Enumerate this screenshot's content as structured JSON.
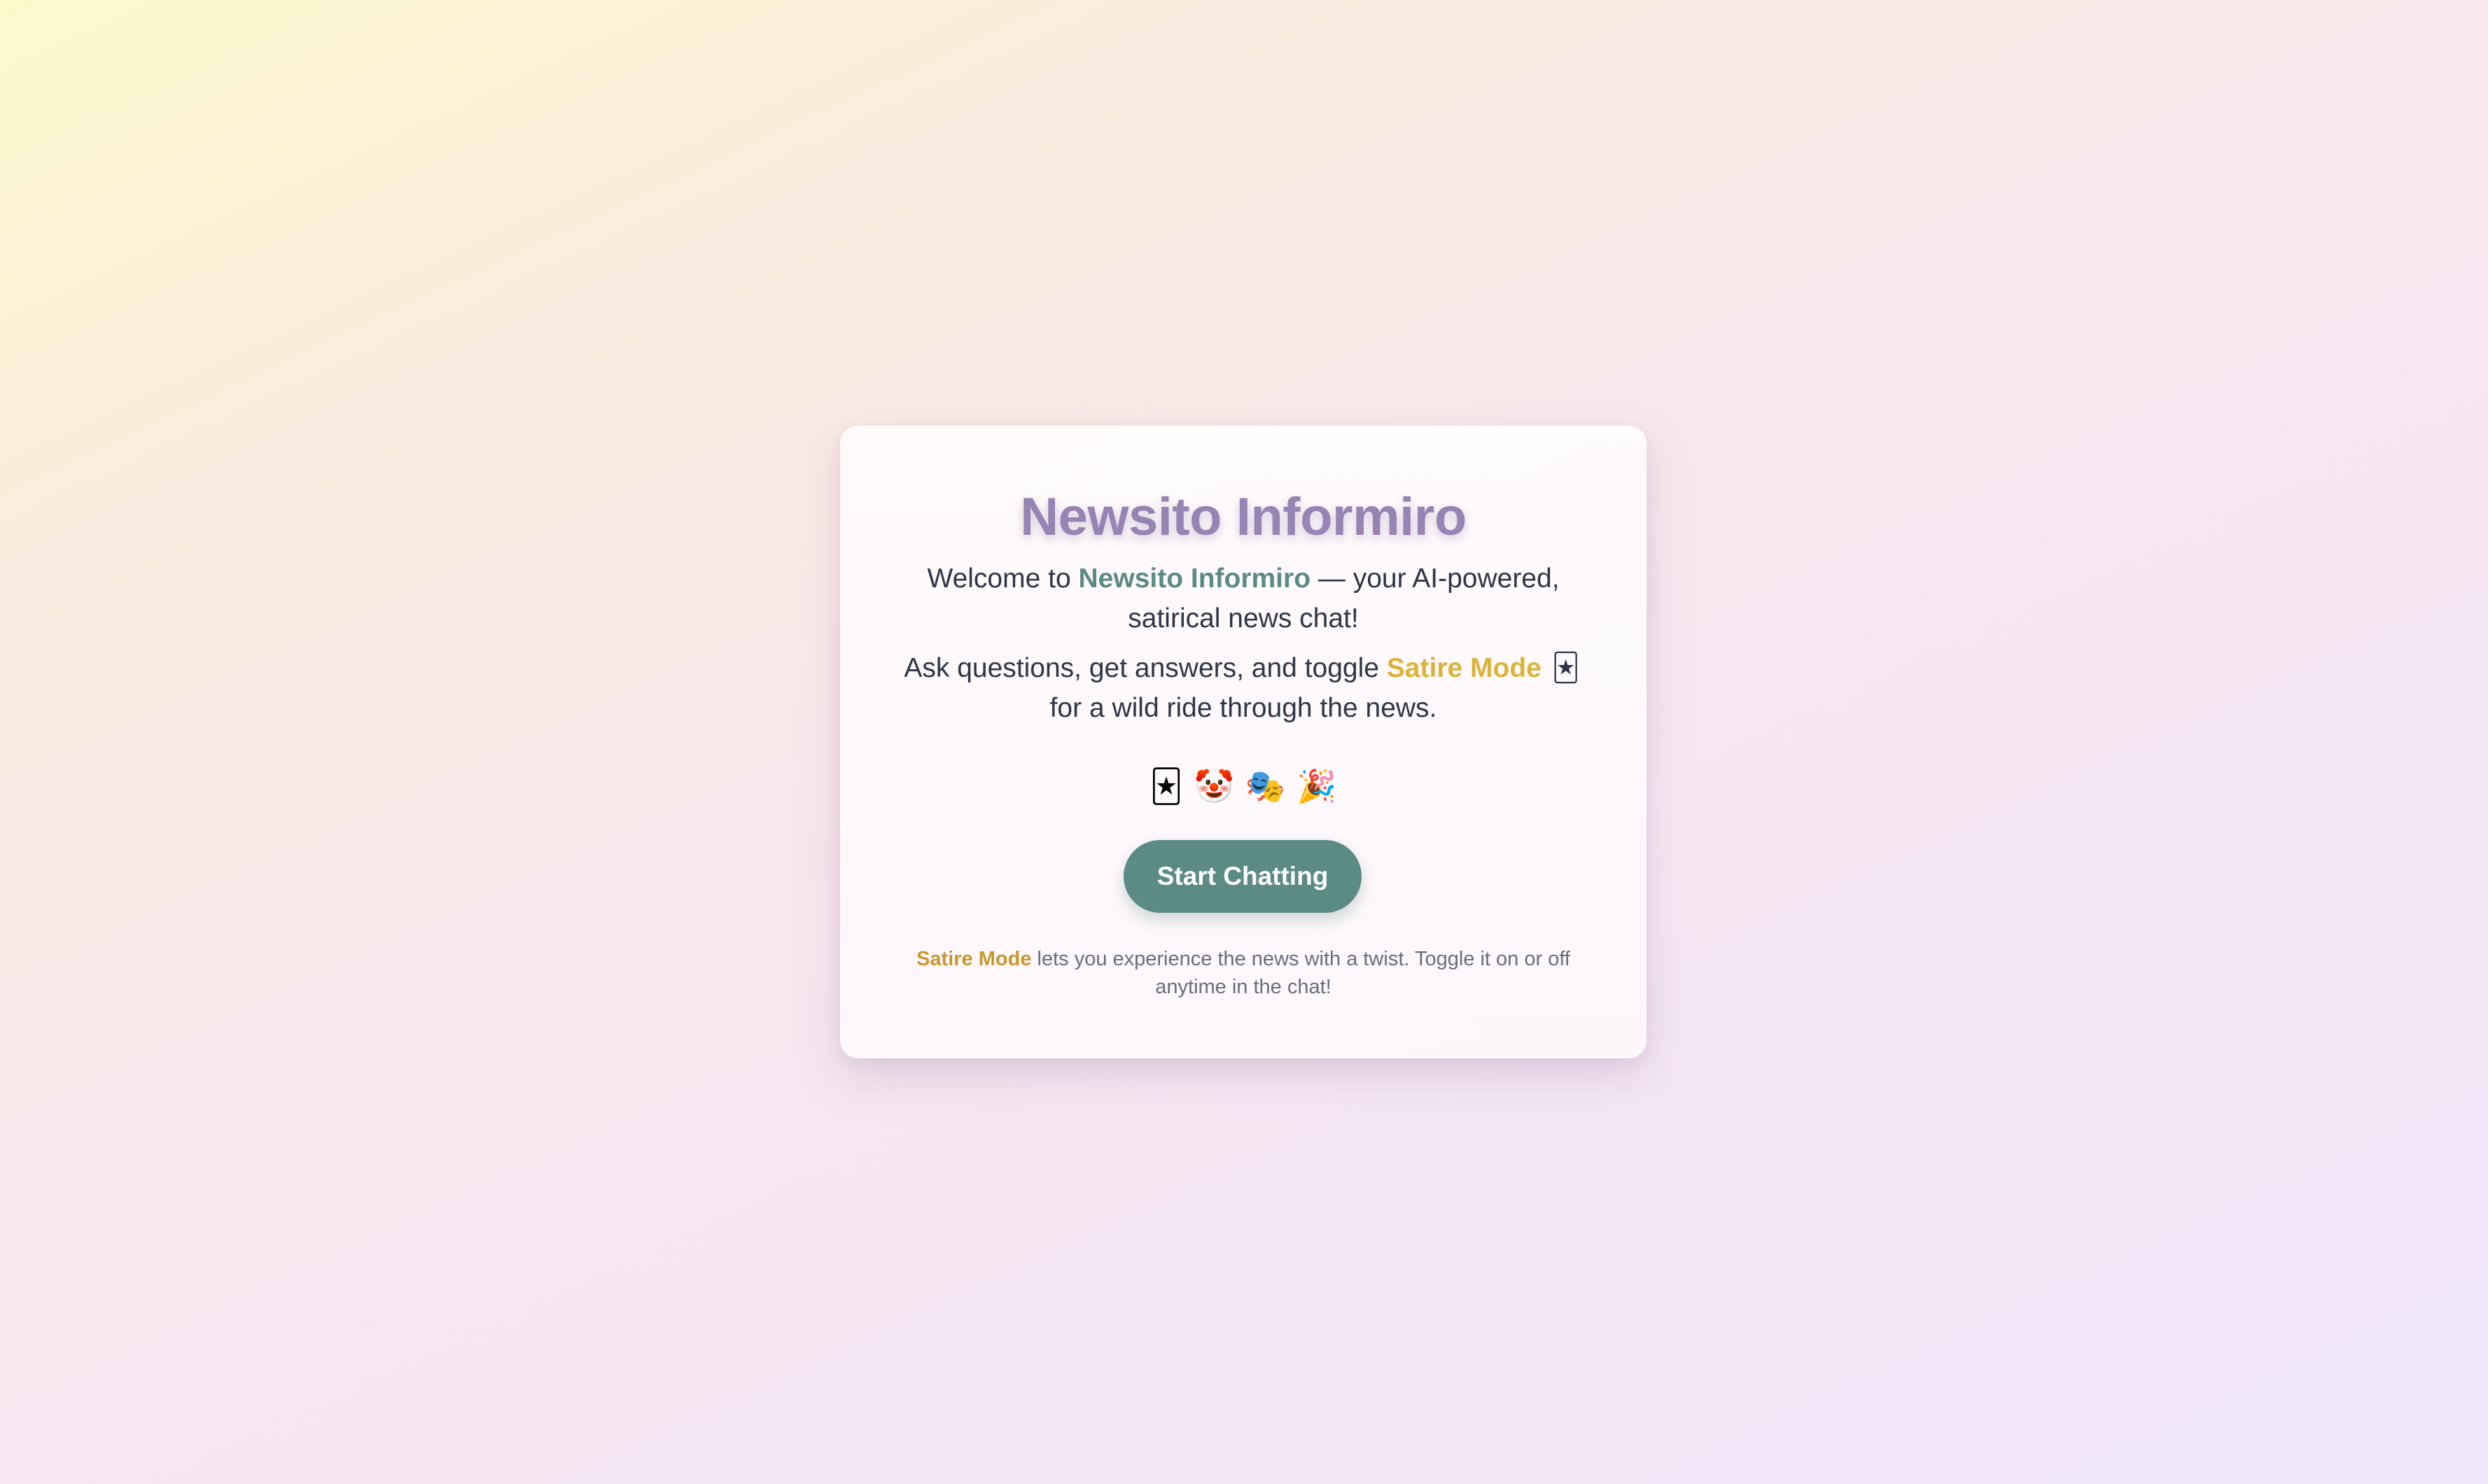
{
  "card": {
    "title": "Newsito Informiro",
    "intro_line1": {
      "prefix": "Welcome to ",
      "brand": "Newsito Informiro",
      "suffix": " — your AI-powered, satirical news chat!"
    },
    "intro_line2": {
      "prefix": "Ask questions, get answers, and toggle ",
      "satire_mode": "Satire Mode",
      "emoji": "🃏",
      "suffix": " for a wild ride through the news."
    },
    "emoji_row": [
      "🃏",
      "🤡",
      "🎭",
      "🎉"
    ],
    "start_button_label": "Start Chatting",
    "note": {
      "highlight": "Satire Mode",
      "text": " lets you experience the news with a twist. Toggle it on or off anytime in the chat!"
    }
  },
  "icons": [
    "joker-card-icon",
    "clown-face-icon",
    "theater-masks-icon",
    "party-popper-icon"
  ],
  "colors": {
    "title": "#9783b4",
    "brand_accent": "#5c8b85",
    "satire_accent": "#dcb33a",
    "note_highlight": "#c9962e",
    "body_text": "#2f3646",
    "muted_text": "#6c6d7b",
    "button_bg": "#5c8b85",
    "button_text": "#ffffff"
  }
}
